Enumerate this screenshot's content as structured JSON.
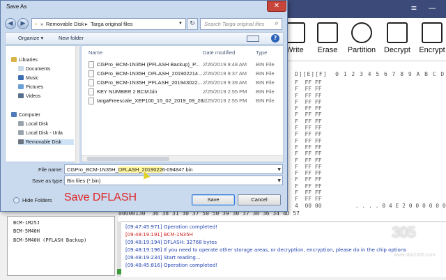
{
  "dialog": {
    "title": "Save As",
    "close_glyph": "✕",
    "nav": {
      "back_glyph": "◀",
      "forward_glyph": "▶",
      "refresh_glyph": "↻",
      "search_icon_glyph": "⌕"
    },
    "address": {
      "separator": "»",
      "segments": [
        "Removable Disk",
        "Targa original files"
      ]
    },
    "search_placeholder": "Search Targa original files",
    "toolbar": {
      "organize": "Organize ▾",
      "new_folder": "New folder",
      "help_glyph": "?"
    },
    "sidebar": [
      {
        "label": "Libraries",
        "icon": "library-icon",
        "color": "#d9b44a",
        "selected": false
      },
      {
        "label": "Documents",
        "icon": "documents-icon",
        "color": "#c9d7ea",
        "selected": false
      },
      {
        "label": "Music",
        "icon": "music-icon",
        "color": "#3c6db3",
        "selected": false
      },
      {
        "label": "Pictures",
        "icon": "pictures-icon",
        "color": "#6aa0d8",
        "selected": false
      },
      {
        "label": "Videos",
        "icon": "videos-icon",
        "color": "#5a6e8e",
        "selected": false
      },
      {
        "label": "Computer",
        "icon": "computer-icon",
        "color": "#4d7cb8",
        "selected": false
      },
      {
        "label": "Local Disk",
        "icon": "disk-icon",
        "color": "#9aa3ad",
        "selected": false
      },
      {
        "label": "Local Disk - Unla",
        "icon": "disk-icon",
        "color": "#9aa3ad",
        "selected": false
      },
      {
        "label": "Removable Disk",
        "icon": "removable-disk-icon",
        "color": "#6d7580",
        "selected": true
      }
    ],
    "columns": {
      "name": "Name",
      "date": "Date modified",
      "type": "Type"
    },
    "files": [
      {
        "name": "CGPro_BCM-1N35H (PFLASH Backup)_P...",
        "date": "2/26/2019 9:48 AM",
        "type": "BIN File"
      },
      {
        "name": "CGPro_BCM-1N35H_DFLASH_201902214...",
        "date": "2/26/2019 9:37 AM",
        "type": "BIN File"
      },
      {
        "name": "CGPro_BCM-1N35H_PFLASH_201943022...",
        "date": "2/26/2019 9:39 AM",
        "type": "BIN File"
      },
      {
        "name": "KEY NUMBER 2 BCM.bin",
        "date": "2/25/2019 2:55 PM",
        "type": "BIN File"
      },
      {
        "name": "targaFreescale_XEP100_15_02_2019_09_28...",
        "date": "2/25/2019 2:55 PM",
        "type": "BIN File"
      }
    ],
    "filename": {
      "label": "File name:",
      "value_pre": "CGPro_BCM-1N35H_",
      "value_hl": "DFLASH_2019022",
      "value_post": "6-094847.bin"
    },
    "savetype": {
      "label": "Save as type:",
      "value": "Bin files (*.bin)"
    },
    "hide_folders": "Hide Folders",
    "caption": "Save DFLASH",
    "save_button": "Save",
    "cancel_button": "Cancel"
  },
  "app": {
    "window_controls": [
      "≡",
      "—"
    ],
    "tools": [
      {
        "label": "Write",
        "icon": "write-icon"
      },
      {
        "label": "Erase",
        "icon": "erase-icon"
      },
      {
        "label": "Partition",
        "icon": "partition-icon"
      },
      {
        "label": "Decrypt",
        "icon": "decrypt-lock-icon"
      },
      {
        "label": "Encrypt",
        "icon": "encrypt-lock-icon"
      }
    ],
    "hex_header": "D][E][F]  0 1 2 3 4 5 6 7 8 9 A B C D E F",
    "hex_rows": "F  FF FF\nF  FF FF\nF  FF FF\nF  FF FF\nF  FF FF\nF  FF FF\nF  FF FF\nF  FF FF\nF  FF FF\nF  FF FF\nF  FF FF\nF  FF FF\nF  FF FF\nF  FF FF\nF  FF FF\nF  FF FF\nF  FF FF\nF  FF FF\nF  FF FF\n4  00 00          . . . . 0 4 E 2 0 0 0 0 0 0\nF  4B 4D     . . . 0 0 0 7 P P 9 0 7 0 6 4 K M\n2  53 31 33      . . . W P 0 B B 2 A 9 6 H S 1 3\n8  4D 57     5 6 8 1 0 7 P P 9 0 7 0 6 4 M W",
    "hex_bottom_addr": "00000130",
    "hex_bottom_vals": "36 38 31 30 37 50 50 39 30 37 30 36 34 4D 57",
    "left_panel": [
      "BCM-1M25J",
      "BCM-5M40H",
      "BCM-5M40H (PFLASH Backup)"
    ],
    "log": [
      {
        "ts": "[09:47:45:971]",
        "text": "Operation completed!",
        "red": false
      },
      {
        "ts": "[09:48:19:191]",
        "text": "BCM-1N35H",
        "red": true
      },
      {
        "ts": "[09:48:19:194]",
        "text": "DFLASH: 32768 bytes",
        "red": false
      },
      {
        "ts": "[09:48:19:196]",
        "text": "If you need to operate other storage areas, or decryption, encryption, please do in the chip options",
        "red": false
      },
      {
        "ts": "[09:48:19:234]",
        "text": "Start reading...",
        "red": false
      },
      {
        "ts": "[09:48:45:816]",
        "text": "Operation completed!",
        "red": false
      }
    ],
    "brand_num": "305",
    "brand_url": "www.obd2305.com"
  }
}
